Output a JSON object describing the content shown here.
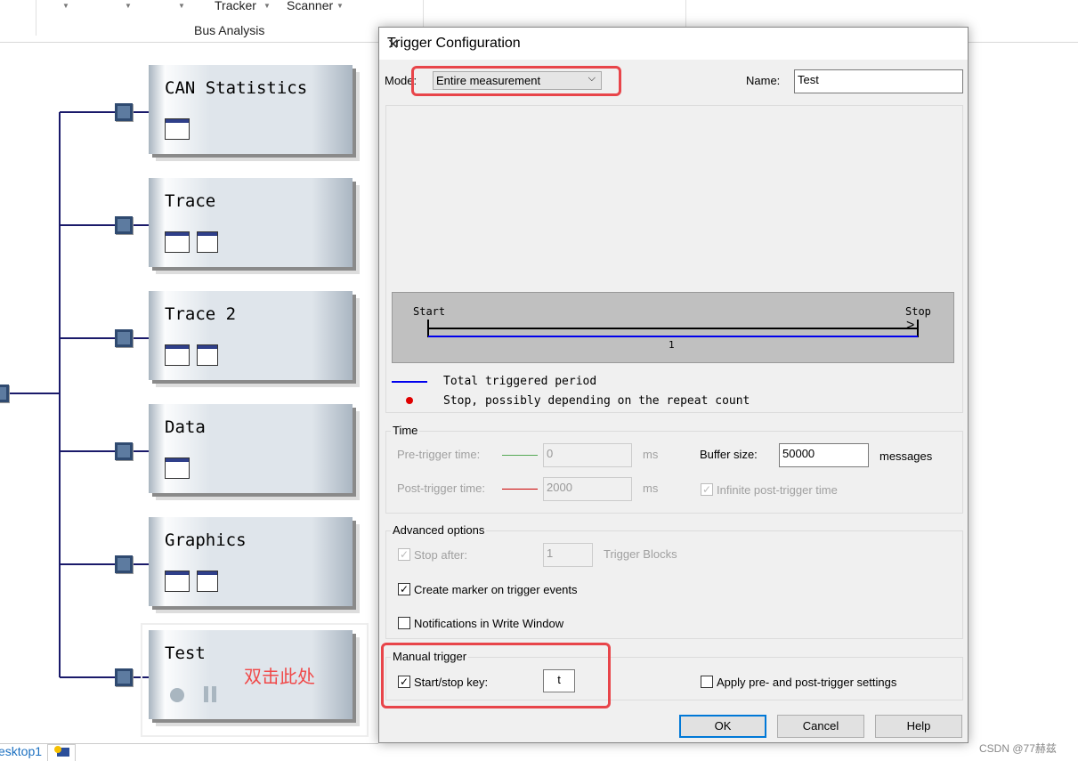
{
  "ribbon": {
    "items": [
      "Tracker",
      "Scanner"
    ],
    "group_label": "Bus Analysis"
  },
  "blocks": [
    {
      "title": "CAN Statistics",
      "icons": [
        "statistics-table-icon"
      ]
    },
    {
      "title": "Trace",
      "icons": [
        "trace-window-icon",
        "config-icon"
      ]
    },
    {
      "title": "Trace 2",
      "icons": [
        "trace-window-icon",
        "config-icon"
      ]
    },
    {
      "title": "Data",
      "icons": [
        "data-window-icon"
      ]
    },
    {
      "title": "Graphics",
      "icons": [
        "graphics-window-icon",
        "config-icon"
      ]
    },
    {
      "title": "Test",
      "icons": [
        "record-icon",
        "pause-icon"
      ],
      "annotation": "双击此处"
    }
  ],
  "bottom_tab": {
    "label": "esktop1"
  },
  "dialog": {
    "title": "Trigger Configuration",
    "mode_label": "Mode:",
    "mode_value": "Entire measurement",
    "name_label": "Name:",
    "name_value": "Test",
    "diagram": {
      "start": "Start",
      "stop": "Stop",
      "segment": "1"
    },
    "legend": [
      "Total triggered period",
      "Stop, possibly depending on the repeat count"
    ],
    "time": {
      "label": "Time",
      "pre_label": "Pre-trigger time:",
      "pre_value": "0",
      "post_label": "Post-trigger time:",
      "post_value": "2000",
      "unit": "ms",
      "buffer_label": "Buffer size:",
      "buffer_value": "50000",
      "buffer_unit": "messages",
      "infinite_label": "Infinite post-trigger time",
      "infinite_checked": true
    },
    "advanced": {
      "label": "Advanced options",
      "stop_after_label": "Stop after:",
      "stop_after_checked": true,
      "stop_after_value": "1",
      "blocks_label": "Trigger Blocks",
      "marker_label": "Create marker on trigger events",
      "marker_checked": true,
      "notify_label": "Notifications in Write Window",
      "notify_checked": false
    },
    "manual": {
      "label": "Manual trigger",
      "key_label": "Start/stop key:",
      "key_checked": true,
      "key_value": "t",
      "apply_label": "Apply pre- and post-trigger settings",
      "apply_checked": false
    },
    "buttons": {
      "ok": "OK",
      "cancel": "Cancel",
      "help": "Help"
    }
  },
  "watermark": "CSDN @77赫兹",
  "colors": {
    "highlight": "#e8454a",
    "annotation": "#f04848"
  }
}
